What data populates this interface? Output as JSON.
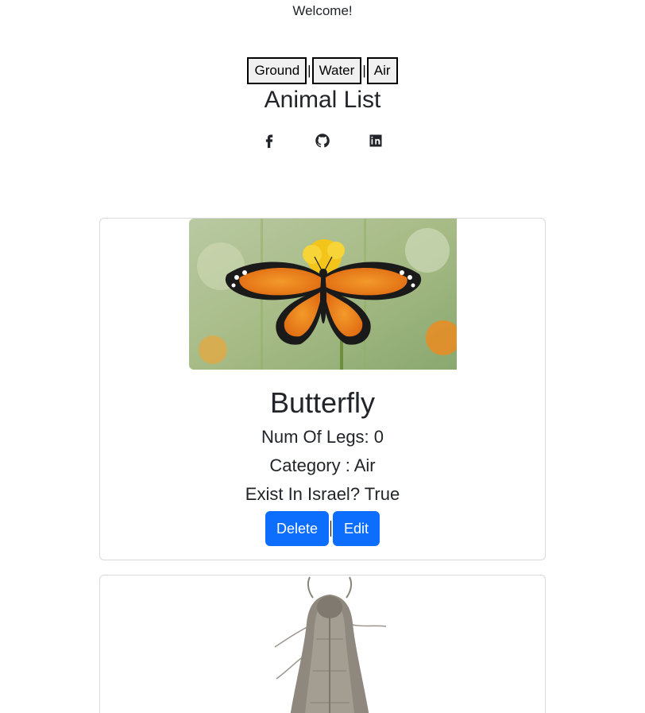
{
  "header": {
    "welcome": "Welcome!",
    "filters": [
      "Ground",
      "Water",
      "Air"
    ],
    "title": "Animal List"
  },
  "social": [
    {
      "icon": "facebook-icon"
    },
    {
      "icon": "github-icon"
    },
    {
      "icon": "linkedin-icon"
    }
  ],
  "animals": [
    {
      "name": "Butterfly",
      "legs_text": "Num Of Legs: 0",
      "category_text": "Category : Air",
      "exists_text": "Exist In Israel? True",
      "image": "butterfly-photo"
    },
    {
      "image": "moth-photo"
    }
  ],
  "actions": {
    "delete_label": "Delete",
    "edit_label": "Edit"
  },
  "colors": {
    "primary": "#0d6efd",
    "text": "#212529",
    "card_border": "#d9d9d9"
  }
}
